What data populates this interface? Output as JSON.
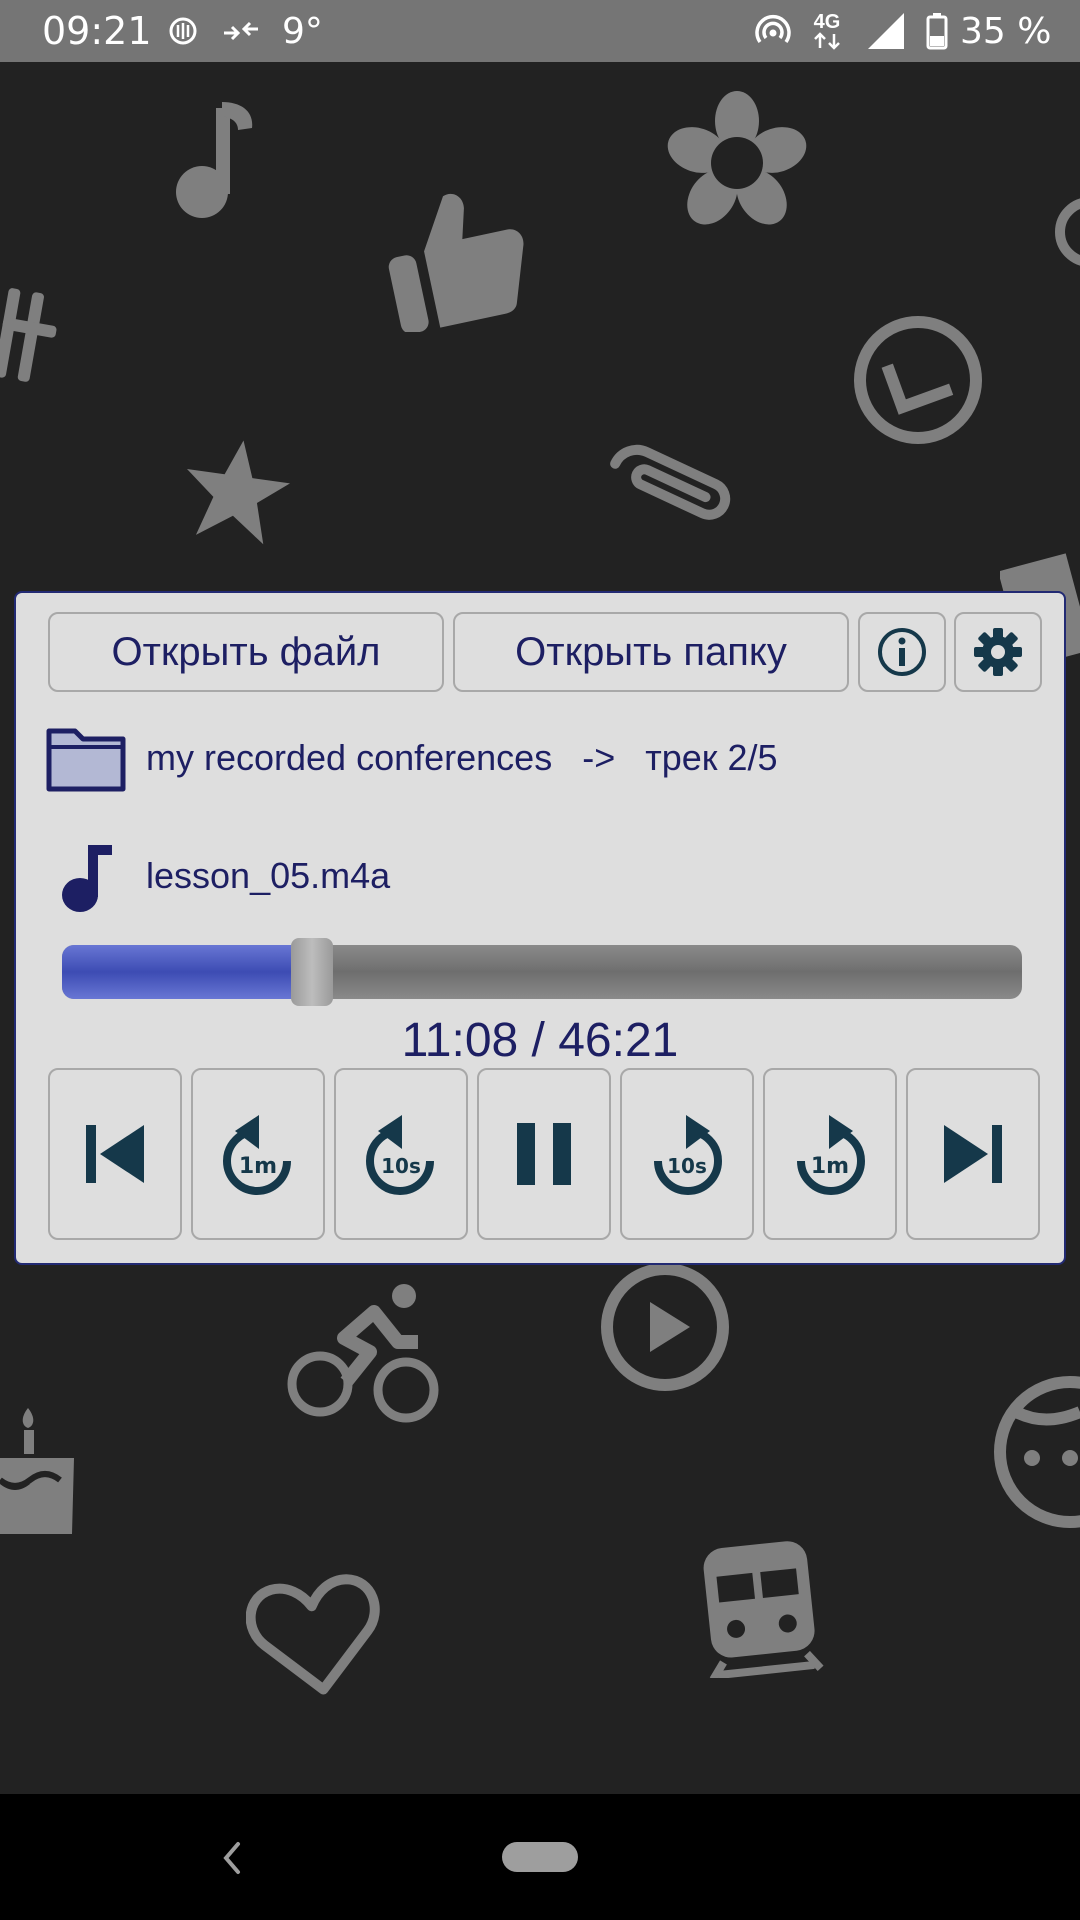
{
  "status_bar": {
    "time": "09:21",
    "temperature": "9°",
    "network": "4G",
    "battery": "35 %",
    "icons": [
      "vpn-icon",
      "data-saver-icon",
      "hotspot-icon",
      "signal-icon",
      "battery-icon"
    ]
  },
  "player": {
    "open_file_label": "Открыть файл",
    "open_folder_label": "Открыть папку",
    "folder_name": "my recorded conferences",
    "arrow": "->",
    "track_info": "трек 2/5",
    "file_name": "lesson_05.m4a",
    "progress_fraction": 0.24,
    "time_display": "11:08 / 46:21",
    "controls": [
      {
        "name": "previous-track-button",
        "icon": "skip-previous-icon"
      },
      {
        "name": "rewind-1m-button",
        "icon": "replay-1m-icon",
        "label": "1m"
      },
      {
        "name": "rewind-10s-button",
        "icon": "replay-10s-icon",
        "label": "10s"
      },
      {
        "name": "pause-button",
        "icon": "pause-icon"
      },
      {
        "name": "forward-10s-button",
        "icon": "forward-10s-icon",
        "label": "10s"
      },
      {
        "name": "forward-1m-button",
        "icon": "forward-1m-icon",
        "label": "1m"
      },
      {
        "name": "next-track-button",
        "icon": "skip-next-icon"
      }
    ]
  },
  "colors": {
    "accent": "#1d1f63",
    "control_icon": "#15384a",
    "progress_fill": "#4452bb",
    "panel_bg": "#dedede",
    "wallpaper_bg": "#222222"
  }
}
